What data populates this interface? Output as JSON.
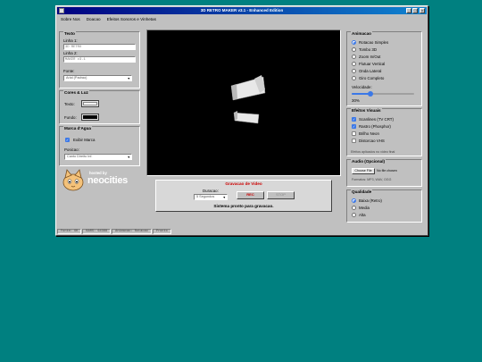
{
  "window": {
    "title": "3D RETRO MAKER v3.1 - Enhanced Edition"
  },
  "menu": [
    "Sobre Nos",
    "Doacao",
    "Efeitos Sonoros e Vinhetas"
  ],
  "texto": {
    "title": "Texto",
    "linha1_label": "Linha 1:",
    "linha1_value": "3D RETRO",
    "linha2_label": "Linha 2:",
    "linha2_value": "MAKER v3.1",
    "fonte_label": "Fonte:",
    "fonte_value": "Arial (Padrao)"
  },
  "cores": {
    "title": "Cores & Luz",
    "texto_label": "Texto:",
    "fundo_label": "Fundo:",
    "texto_color": "#ffffff",
    "fundo_color": "#000000"
  },
  "marca": {
    "title": "Marca d'Agua",
    "exibir_label": "Exibir Marca",
    "exibir_checked": true,
    "posicao_label": "Posicao:",
    "posicao_value": "Canto Direito Inf."
  },
  "neocities": {
    "hosted": "hosted by",
    "name": "neocities"
  },
  "gravacao": {
    "title": "Gravacao de Video",
    "duracao_label": "Duracao:",
    "duracao_value": "5 Segundos",
    "rec_label": "REC",
    "stop_label": "STOP",
    "status": "Sistema pronto para gravacao."
  },
  "animacao": {
    "title": "Animacao",
    "options": [
      "Rotacao Simples",
      "Tombo 3D",
      "Zoom In/Out",
      "Flutuar Vertical",
      "Onda Lateral",
      "Giro Completo"
    ],
    "selected": 0,
    "velocidade_label": "Velocidade:",
    "velocidade_value": "30%",
    "velocidade_level": 0.3
  },
  "efeitos": {
    "title": "Efeitos Visuais",
    "options": [
      {
        "label": "Scanlines (TV CRT)",
        "checked": true
      },
      {
        "label": "Rastro (Phosphor)",
        "checked": true
      },
      {
        "label": "Brilho Neon",
        "checked": false
      },
      {
        "label": "Distorcao VHS",
        "checked": false
      }
    ],
    "note": "Efeitos aplicados no video final"
  },
  "audio": {
    "title": "Audio (Opcional)",
    "choose_label": "Choose File",
    "no_file": "No file chosen",
    "formats": "Formatos: MP3, WAV, OGG"
  },
  "qualidade": {
    "title": "Qualidade",
    "options": [
      "Baixa (Retro)",
      "Media",
      "Alta"
    ],
    "selected": 0
  },
  "status": [
    "Fonte: OK",
    "BARS: 64368",
    "Animacao: Rotacao",
    "Pronto"
  ],
  "colors": {
    "desktop": "#008080",
    "titlebar": "#000080",
    "accent": "#3b78e7",
    "rec": "#cc0000"
  }
}
